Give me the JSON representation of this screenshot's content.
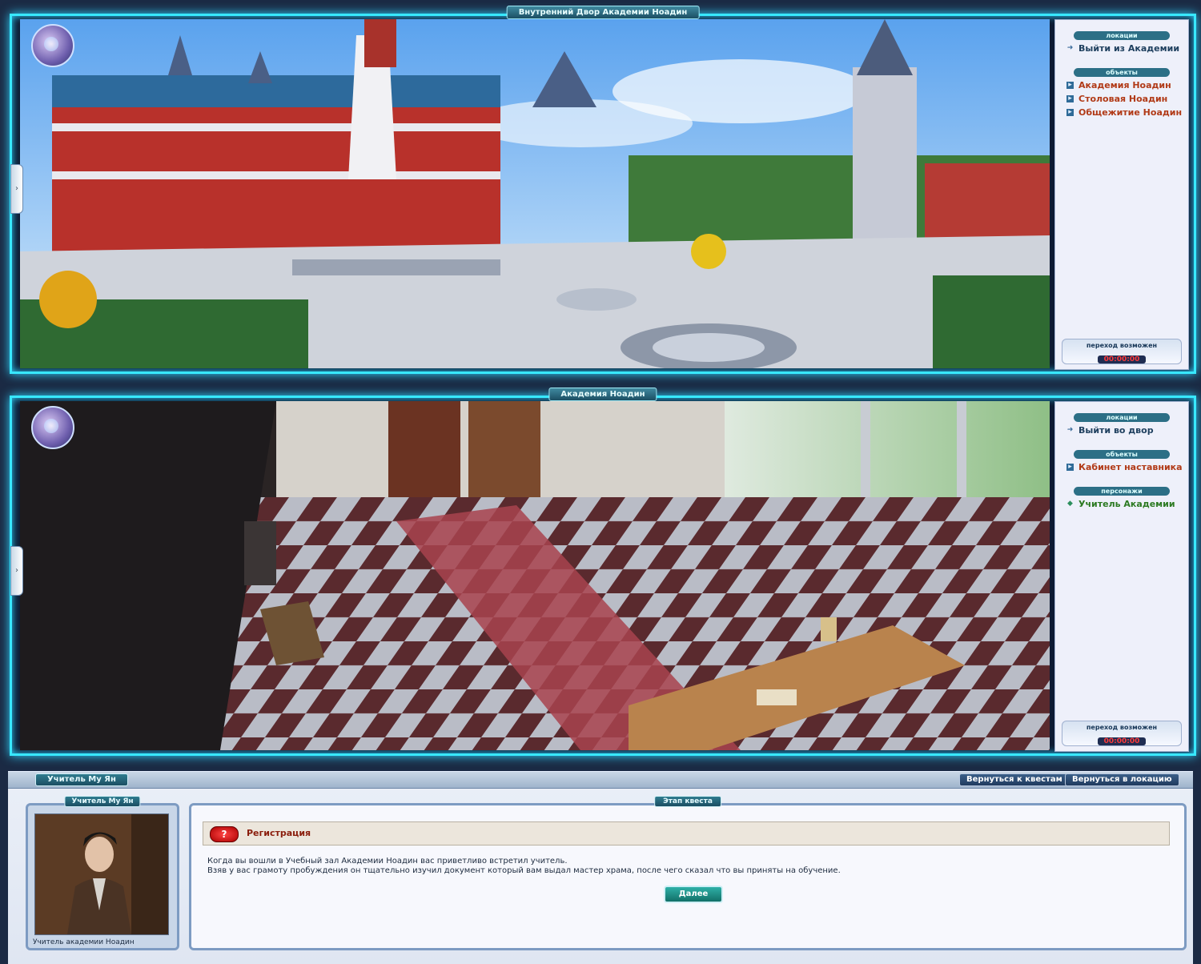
{
  "scene1": {
    "title": "Внутренний Двор Академии Ноадин",
    "menu": {
      "locations_head": "локации",
      "locations": [
        "Выйти из Академии"
      ],
      "objects_head": "объекты",
      "objects": [
        "Академия Ноадин",
        "Столовая Ноадин",
        "Общежитие Ноадин"
      ],
      "transition": "переход возможен",
      "timer": "00:00:00"
    }
  },
  "scene2": {
    "title": "Академия Ноадин",
    "menu": {
      "locations_head": "локации",
      "locations": [
        "Выйти во двор"
      ],
      "objects_head": "объекты",
      "objects": [
        "Кабинет наставника"
      ],
      "characters_head": "персонажи",
      "characters": [
        "Учитель Академии"
      ],
      "transition": "переход возможен",
      "timer": "00:00:00"
    }
  },
  "dialog": {
    "npc_tab": "Учитель Му Ян",
    "btn_quests": "Вернуться к квестам",
    "btn_location": "Вернуться в локацию",
    "portrait_name": "Учитель Му Ян",
    "portrait_caption": "Учитель академии Ноадин",
    "stage_tab": "Этап квеста",
    "quest_icon": "?",
    "quest_title": "Регистрация",
    "quest_text_1": "Когда вы вошли в Учебный зал Академии Ноадин вас приветливо встретил учитель.",
    "quest_text_2": "Взяв у вас грамоту пробуждения он тщательно изучил документ который вам выдал мастер храма, после чего сказал что вы приняты на обучение.",
    "next_btn": "Далее"
  },
  "colors": {
    "frame_glow": "#38e8ff",
    "tab_teal": "#2f7c8f",
    "object_link": "#b13a17",
    "character_link": "#2c7a22",
    "timer": "#ff3b3b"
  }
}
